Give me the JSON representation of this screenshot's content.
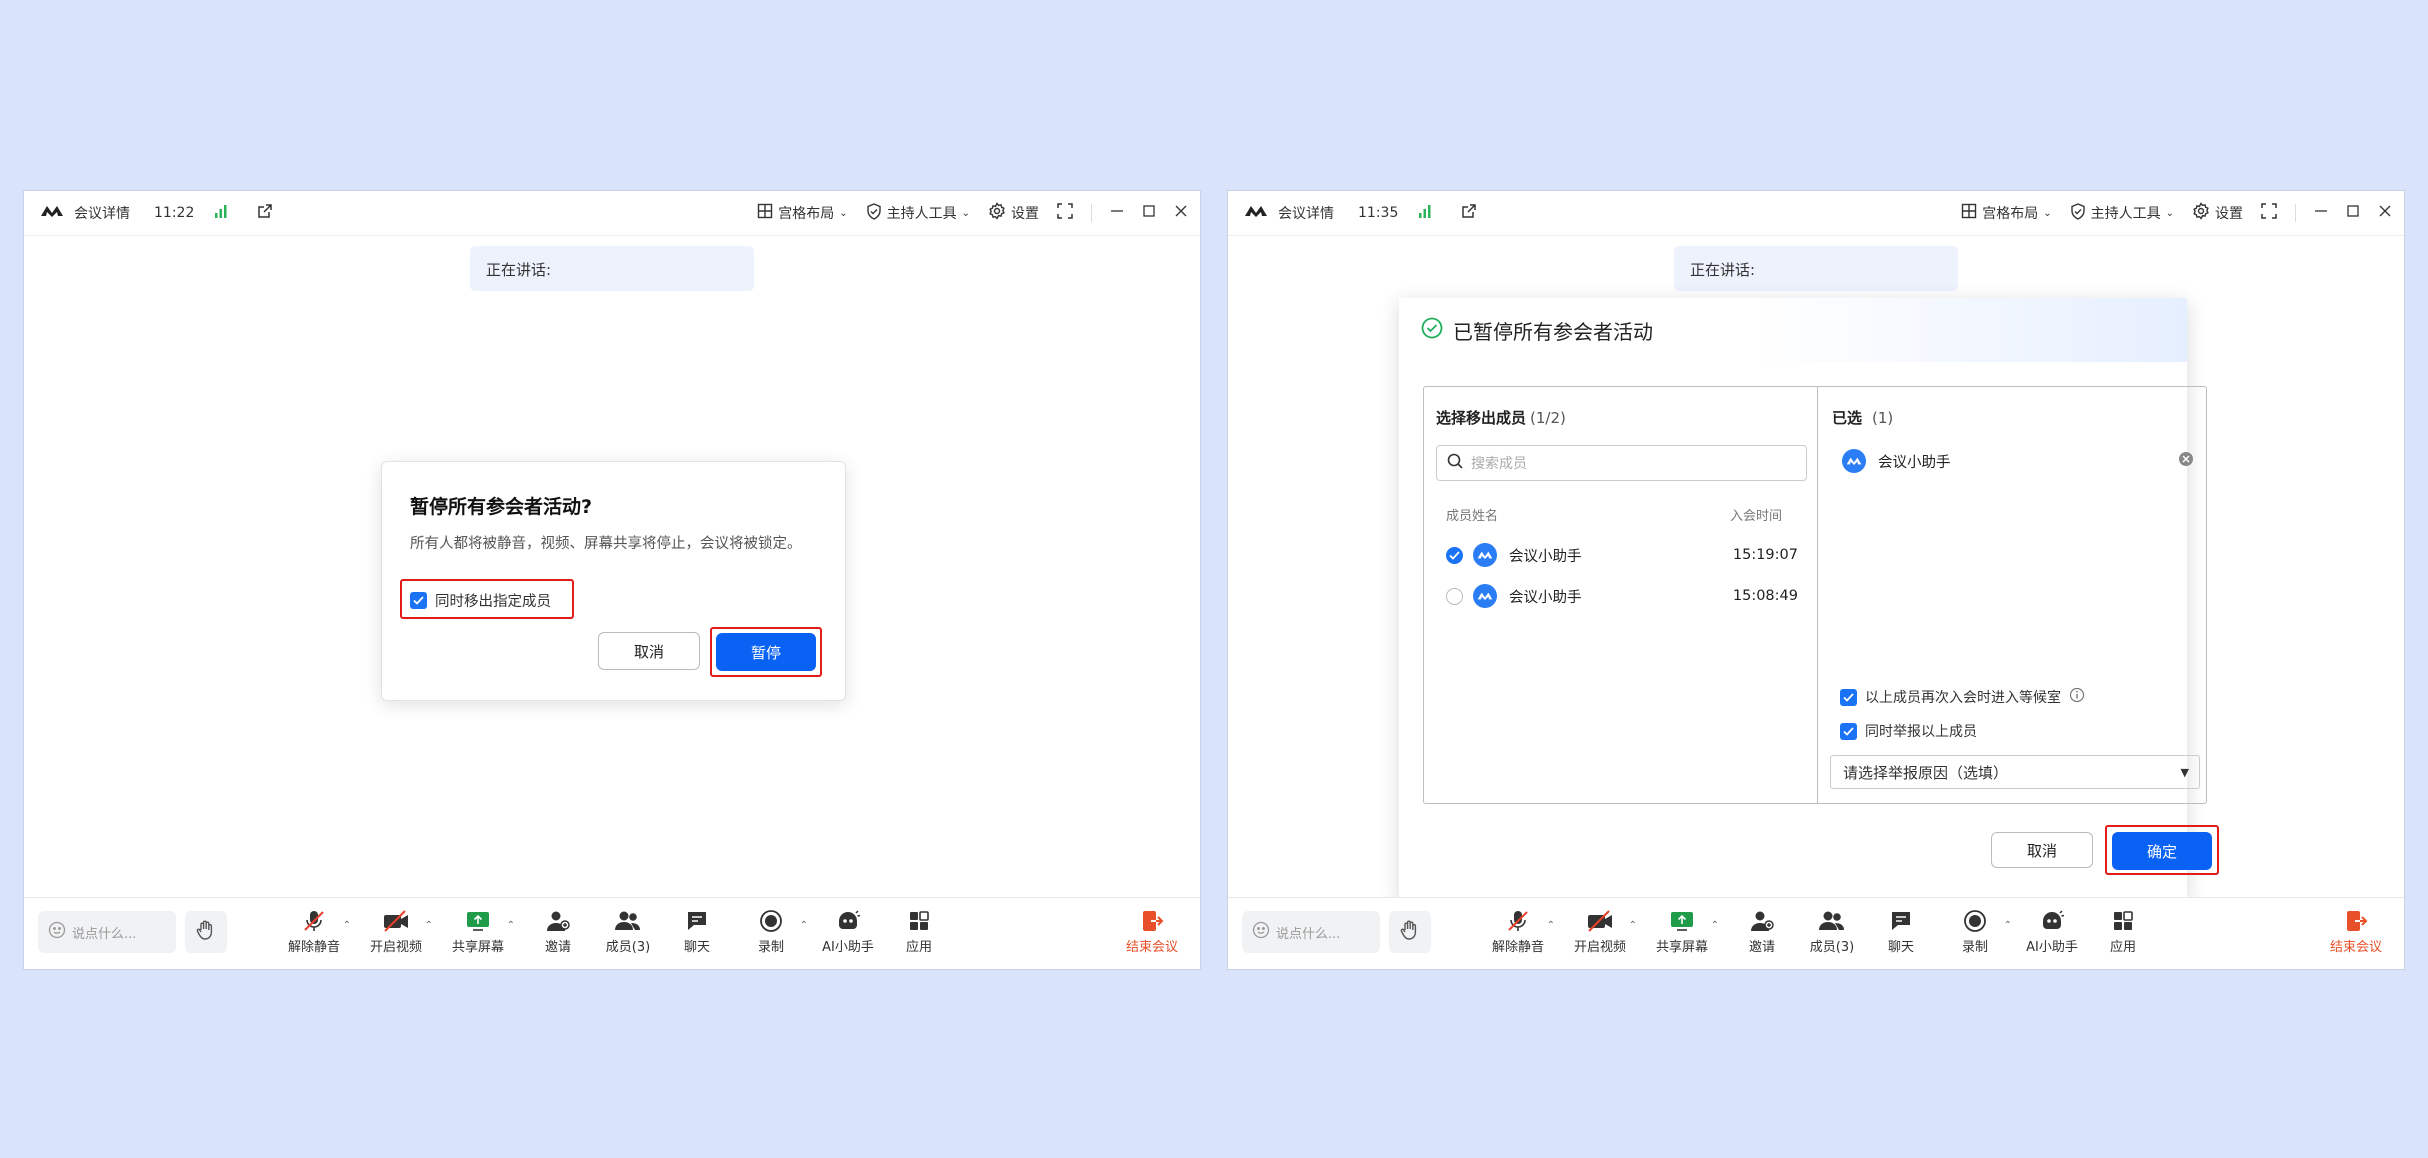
{
  "left": {
    "titlebar": {
      "title": "会议详情",
      "time": "11:22",
      "layout": "宫格布局",
      "host_tools": "主持人工具",
      "settings": "设置"
    },
    "speaker": "正在讲话:",
    "dialog": {
      "title": "暂停所有参会者活动?",
      "desc": "所有人都将被静音，视频、屏幕共享将停止，会议将被锁定。",
      "checkbox": "同时移出指定成员",
      "cancel": "取消",
      "confirm": "暂停"
    }
  },
  "right": {
    "titlebar": {
      "title": "会议详情",
      "time": "11:35",
      "layout": "宫格布局",
      "host_tools": "主持人工具",
      "settings": "设置"
    },
    "speaker": "正在讲话:",
    "dialog": {
      "title": "已暂停所有参会者活动",
      "left_title": "选择移出成员",
      "left_count": "(1/2)",
      "search_placeholder": "搜索成员",
      "col_name": "成员姓名",
      "col_time": "入会时间",
      "members": [
        {
          "name": "会议小助手",
          "time": "15:19:07",
          "checked": true
        },
        {
          "name": "会议小助手",
          "time": "15:08:49",
          "checked": false
        }
      ],
      "selected_title": "已选",
      "selected_count": "(1)",
      "selected": [
        {
          "name": "会议小助手"
        }
      ],
      "opt_waiting_room": "以上成员再次入会时进入等候室",
      "opt_report": "同时举报以上成员",
      "report_select": "请选择举报原因（选填）",
      "cancel": "取消",
      "confirm": "确定"
    }
  },
  "toolbar": {
    "chat_placeholder": "说点什么...",
    "unmute": "解除静音",
    "video": "开启视频",
    "share": "共享屏幕",
    "invite": "邀请",
    "members": "成员(3)",
    "chat": "聊天",
    "record": "录制",
    "ai": "AI小助手",
    "apps": "应用",
    "end": "结束会议"
  },
  "colors": {
    "background": "#d9e4fb",
    "primary": "#0a62f5",
    "highlight": "#e21b1b",
    "end": "#e8502a",
    "signal": "#2bb35a"
  },
  "icons": [
    "tencent-meeting-logo-icon",
    "signal-icon",
    "external-link-icon",
    "grid-icon",
    "shield-icon",
    "gear-icon",
    "fullscreen-icon",
    "minimize-icon",
    "maximize-icon",
    "close-icon",
    "emoji-icon",
    "hand-icon",
    "mic-off-icon",
    "video-off-icon",
    "share-screen-icon",
    "invite-icon",
    "members-icon",
    "chat-icon",
    "record-icon",
    "ai-assistant-icon",
    "apps-icon",
    "end-meeting-icon",
    "check-circle-icon",
    "search-icon",
    "clear-icon",
    "info-icon",
    "dropdown-arrow-icon"
  ]
}
